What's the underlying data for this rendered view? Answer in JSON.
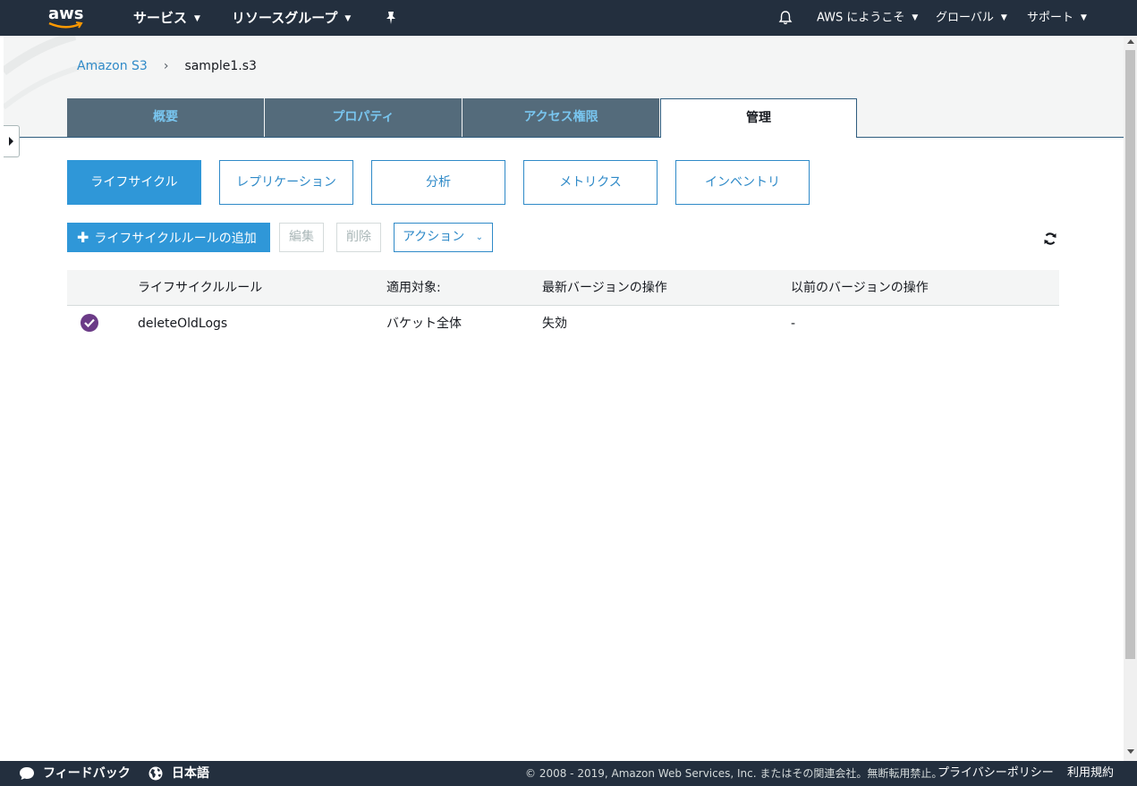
{
  "topnav": {
    "logo_text": "aws",
    "services": "サービス",
    "resource_groups": "リソースグループ",
    "welcome": "AWS にようこそ",
    "region": "グローバル",
    "support": "サポート"
  },
  "breadcrumb": {
    "root": "Amazon S3",
    "separator": "›",
    "current": "sample1.s3"
  },
  "tabs": [
    "概要",
    "プロパティ",
    "アクセス権限",
    "管理"
  ],
  "subtabs": [
    "ライフサイクル",
    "レプリケーション",
    "分析",
    "メトリクス",
    "インベントリ"
  ],
  "toolbar": {
    "add_label": "ライフサイクルルールの追加",
    "edit_label": "編集",
    "delete_label": "削除",
    "actions_label": "アクション"
  },
  "table": {
    "headers": [
      "ライフサイクルルール",
      "適用対象:",
      "最新バージョンの操作",
      "以前のバージョンの操作"
    ],
    "rows": [
      {
        "name": "deleteOldLogs",
        "scope": "バケット全体",
        "current_action": "失効",
        "previous_action": "-"
      }
    ]
  },
  "footer": {
    "feedback": "フィードバック",
    "language": "日本語",
    "copyright": "© 2008 - 2019, Amazon Web Services, Inc. またはその関連会社。無断転用禁止。",
    "privacy": "プライバシーポリシー",
    "terms": "利用規約"
  },
  "colors": {
    "nav_bg": "#232f3e",
    "accent": "#2f97d8",
    "tab_bg": "#546b7b",
    "tab_text": "#79c6f0",
    "check": "#6b3b87"
  }
}
